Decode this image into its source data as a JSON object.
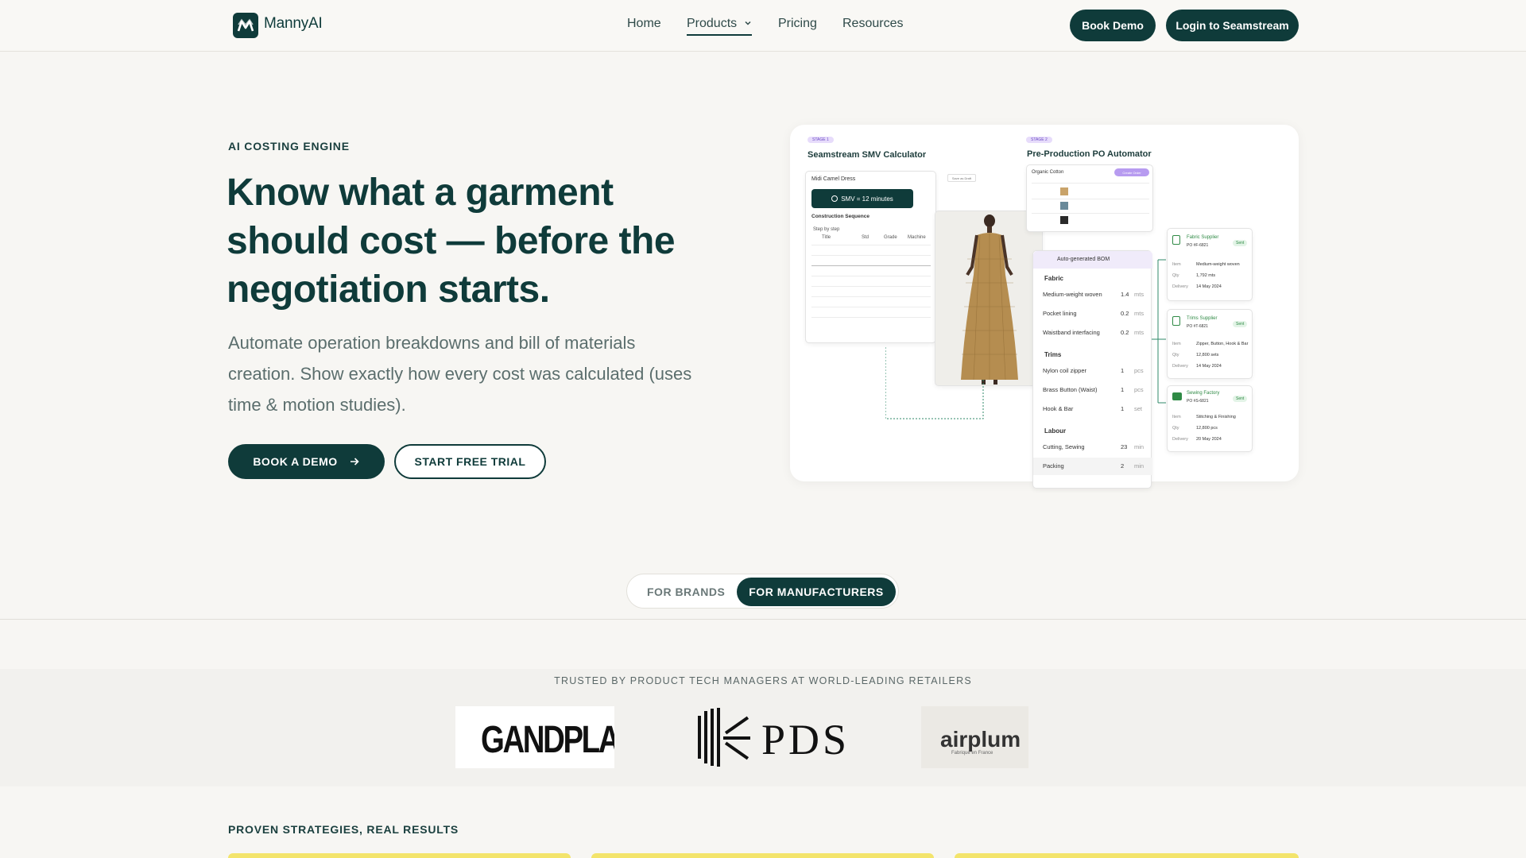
{
  "nav": {
    "brand": "MannyAI",
    "links": [
      "Home",
      "Products",
      "Pricing",
      "Resources"
    ],
    "book_demo": "Book Demo",
    "login": "Login to Seamstream"
  },
  "hero": {
    "eyebrow": "AI COSTING ENGINE",
    "headline": "Know what a garment should cost — before the negotiation starts.",
    "subtext": "Automate operation breakdowns and bill of materials creation. Show exactly how every cost was calculated (uses time & motion studies).",
    "cta_primary": "BOOK A DEMO",
    "cta_secondary": "START FREE TRIAL"
  },
  "illustration": {
    "stage1": "STAGE 1",
    "stage2": "STAGE 2",
    "smv_title": "Seamstream SMV Calculator",
    "po_title": "Pre-Production PO Automator",
    "smv_card": {
      "garment": "Midi Camel Dress",
      "save_btn": "Save as Draft",
      "smv": "SMV = 12 minutes",
      "sequence_title": "Construction Sequence",
      "step_label": "Step by step",
      "headers": [
        "Title",
        "Std",
        "Grade",
        "Machine"
      ]
    },
    "bom": {
      "title": "Auto-generated BOM",
      "sections": [
        {
          "name": "Fabric",
          "items": [
            {
              "name": "Medium-weight woven",
              "qty": "1.4",
              "unit": "mts"
            },
            {
              "name": "Pocket lining",
              "qty": "0.2",
              "unit": "mts"
            },
            {
              "name": "Waistband interfacing",
              "qty": "0.2",
              "unit": "mts"
            }
          ]
        },
        {
          "name": "Trims",
          "items": [
            {
              "name": "Nylon coil zipper",
              "qty": "1",
              "unit": "pcs"
            },
            {
              "name": "Brass Button (Waist)",
              "qty": "1",
              "unit": "pcs"
            },
            {
              "name": "Hook & Bar",
              "qty": "1",
              "unit": "set"
            }
          ]
        },
        {
          "name": "Labour",
          "items": [
            {
              "name": "Cutting, Sewing",
              "qty": "23",
              "unit": "min"
            },
            {
              "name": "Packing",
              "qty": "2",
              "unit": "min"
            }
          ]
        }
      ]
    },
    "po_cards": [
      {
        "title": "Fabric Supplier",
        "po": "PO #F-6821",
        "status": "Sent",
        "item_label": "Item",
        "item": "Medium-weight woven",
        "qty_label": "Qty",
        "qty": "1,792 mts",
        "delivery_label": "Delivery",
        "delivery": "14 May 2024"
      },
      {
        "title": "Trims Supplier",
        "po": "PO #T-6821",
        "status": "Sent",
        "item_label": "Item",
        "item": "Zipper, Button, Hook & Bar",
        "qty_label": "Qty",
        "qty": "12,800 sets",
        "delivery_label": "Delivery",
        "delivery": "14 May 2024"
      },
      {
        "title": "Sewing Factory",
        "po": "PO #S-6821",
        "status": "Sent",
        "item_label": "Item",
        "item": "Stitching & Finishing",
        "qty_label": "Qty",
        "qty": "12,800 pcs",
        "delivery_label": "Delivery",
        "delivery": "20 May 2024"
      }
    ],
    "po_table": {
      "tag": "Organic Cotton",
      "action": "Create Order"
    }
  },
  "toggle": {
    "brands": "FOR BRANDS",
    "manufacturers": "FOR MANUFACTURERS"
  },
  "logos": {
    "trusted": "TRUSTED BY PRODUCT TECH MANAGERS AT WORLD-LEADING RETAILERS",
    "brands": [
      "GANDPLAY",
      "PDS",
      "airplum"
    ],
    "airplum_sub": "Fabriqué en France"
  },
  "proven": "PROVEN STRATEGIES, REAL RESULTS",
  "colors": {
    "primary": "#0f3b3a",
    "background": "#f7f6f3",
    "accent_purple": "#e7dcfb",
    "yellow": "#f3e46b"
  }
}
